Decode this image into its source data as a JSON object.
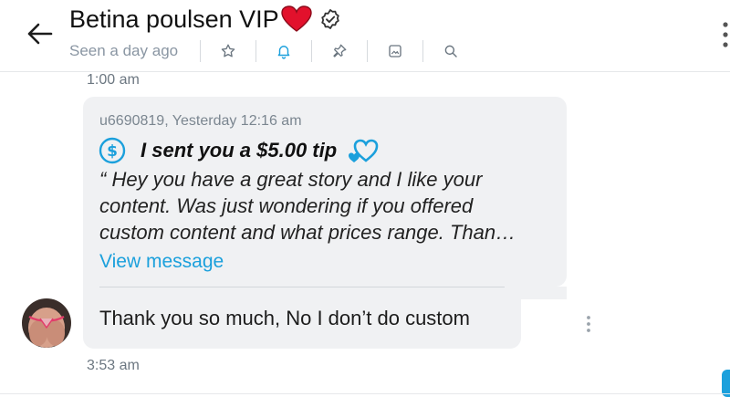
{
  "header": {
    "back_icon": "arrow-left-icon",
    "name": "Betina poulsen VIP",
    "badges": [
      "red-heart-icon",
      "verified-badge-icon"
    ],
    "status": "Seen a day ago",
    "tools": [
      "star-icon",
      "bell-icon",
      "pin-icon",
      "image-icon",
      "search-icon"
    ],
    "more_icon": "kebab-vertical-icon",
    "accent_color": "#1ba0dc"
  },
  "messages": {
    "time_before": "1:00 am",
    "tip": {
      "meta": "u6690819, Yesterday 12:16 am",
      "title": "I sent you a $5.00 tip",
      "quote_lines": [
        "“ Hey you have a great story and I like your",
        "content. Was just wondering if you offered",
        "custom content and what prices range. Than…"
      ],
      "view_label": "View message"
    },
    "reply": {
      "text": "Thank you so much, No I don’t do custom"
    },
    "time_after": "3:53 am"
  }
}
